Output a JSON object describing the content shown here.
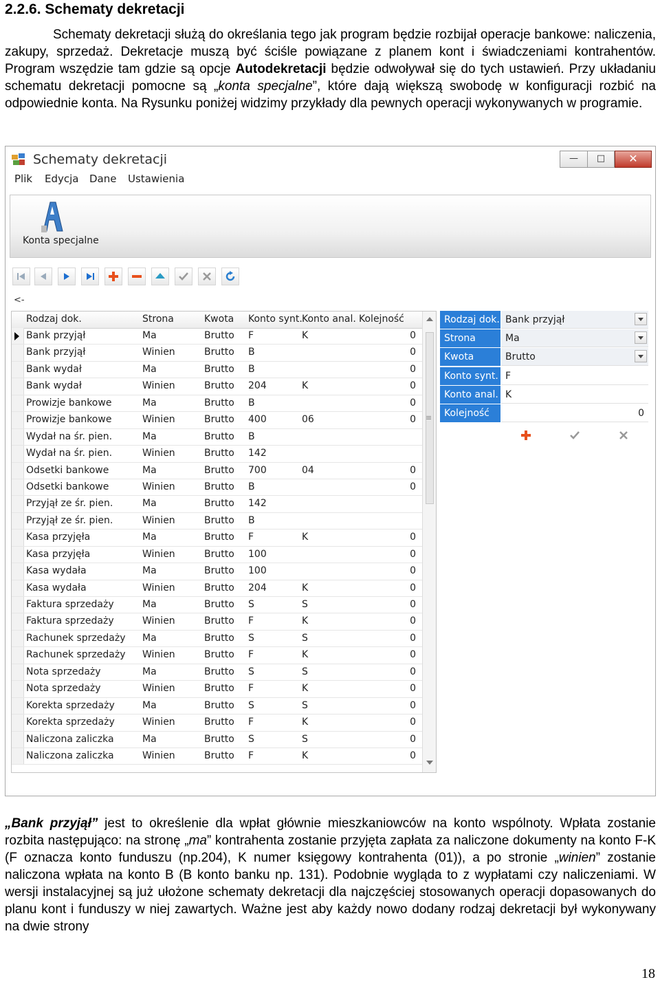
{
  "heading": "2.2.6. Schematy dekretacji",
  "para1": {
    "t1": "Schematy dekretacji służą do określania tego jak program będzie rozbijał operacje bankowe: naliczenia, zakupy, sprzedaż. Dekretacje muszą być ściśle powiązane z planem kont i świadczeniami kontrahentów. Program wszędzie tam gdzie są opcje ",
    "b1": "Autodekretacji",
    "t2": " będzie odwoływał się do tych ustawień. Przy układaniu schematu dekretacji pomocne są „",
    "i1": "konta specjalne",
    "t3": "”, które dają większą swobodę w konfiguracji rozbić na odpowiednie konta. Na Rysunku poniżej widzimy przykłady dla pewnych operacji wykonywanych w programie."
  },
  "window": {
    "title": "Schematy dekretacji",
    "controls": {
      "minimize": "—",
      "maximize": "□",
      "close": "✕"
    },
    "menu": [
      "Plik",
      "Edycja",
      "Dane",
      "Ustawienia"
    ],
    "ribbon_button": "Konta specjalne",
    "collapse": "<-",
    "nav_icons": [
      "first-record-icon",
      "prev-record-icon",
      "next-record-icon",
      "last-record-icon",
      "add-icon",
      "remove-icon",
      "up-icon",
      "confirm-icon",
      "cancel-icon",
      "refresh-icon"
    ],
    "columns": [
      "Rodzaj dok.",
      "Strona",
      "Kwota",
      "Konto synt.",
      "Konto anal.",
      "Kolejność"
    ],
    "rows": [
      [
        "Bank przyjął",
        "Ma",
        "Brutto",
        "F",
        "K",
        "0"
      ],
      [
        "Bank przyjął",
        "Winien",
        "Brutto",
        "B",
        "",
        "0"
      ],
      [
        "Bank wydał",
        "Ma",
        "Brutto",
        "B",
        "",
        "0"
      ],
      [
        "Bank wydał",
        "Winien",
        "Brutto",
        "204",
        "K",
        "0"
      ],
      [
        "Prowizje bankowe",
        "Ma",
        "Brutto",
        "B",
        "",
        "0"
      ],
      [
        "Prowizje bankowe",
        "Winien",
        "Brutto",
        "400",
        "06",
        "0"
      ],
      [
        "Wydał na śr. pien.",
        "Ma",
        "Brutto",
        "B",
        "",
        ""
      ],
      [
        "Wydał na śr. pien.",
        "Winien",
        "Brutto",
        "142",
        "",
        ""
      ],
      [
        "Odsetki bankowe",
        "Ma",
        "Brutto",
        "700",
        "04",
        "0"
      ],
      [
        "Odsetki bankowe",
        "Winien",
        "Brutto",
        "B",
        "",
        "0"
      ],
      [
        "Przyjął ze śr. pien.",
        "Ma",
        "Brutto",
        "142",
        "",
        ""
      ],
      [
        "Przyjął ze śr. pien.",
        "Winien",
        "Brutto",
        "B",
        "",
        ""
      ],
      [
        "Kasa przyjęła",
        "Ma",
        "Brutto",
        "F",
        "K",
        "0"
      ],
      [
        "Kasa przyjęła",
        "Winien",
        "Brutto",
        "100",
        "",
        "0"
      ],
      [
        "Kasa wydała",
        "Ma",
        "Brutto",
        "100",
        "",
        "0"
      ],
      [
        "Kasa wydała",
        "Winien",
        "Brutto",
        "204",
        "K",
        "0"
      ],
      [
        "Faktura sprzedaży",
        "Ma",
        "Brutto",
        "S",
        "S",
        "0"
      ],
      [
        "Faktura sprzedaży",
        "Winien",
        "Brutto",
        "F",
        "K",
        "0"
      ],
      [
        "Rachunek sprzedaży",
        "Ma",
        "Brutto",
        "S",
        "S",
        "0"
      ],
      [
        "Rachunek sprzedaży",
        "Winien",
        "Brutto",
        "F",
        "K",
        "0"
      ],
      [
        "Nota sprzedaży",
        "Ma",
        "Brutto",
        "S",
        "S",
        "0"
      ],
      [
        "Nota sprzedaży",
        "Winien",
        "Brutto",
        "F",
        "K",
        "0"
      ],
      [
        "Korekta sprzedaży",
        "Ma",
        "Brutto",
        "S",
        "S",
        "0"
      ],
      [
        "Korekta sprzedaży",
        "Winien",
        "Brutto",
        "F",
        "K",
        "0"
      ],
      [
        "Naliczona zaliczka",
        "Ma",
        "Brutto",
        "S",
        "S",
        "0"
      ],
      [
        "Naliczona zaliczka",
        "Winien",
        "Brutto",
        "F",
        "K",
        "0"
      ]
    ],
    "detail": [
      {
        "label": "Rodzaj dok.",
        "value": "Bank przyjął",
        "dropdown": true
      },
      {
        "label": "Strona",
        "value": "Ma",
        "dropdown": true
      },
      {
        "label": "Kwota",
        "value": "Brutto",
        "dropdown": true
      },
      {
        "label": "Konto synt.",
        "value": "F",
        "dropdown": false
      },
      {
        "label": "Konto anal.",
        "value": "K",
        "dropdown": false
      },
      {
        "label": "Kolejność",
        "value": "0",
        "dropdown": false,
        "numeric": true
      }
    ],
    "accent_color": "#2b7fd8"
  },
  "para2": {
    "i1": "„Bank przyjął”",
    "t1": " jest to określenie dla wpłat głównie mieszkaniowców na konto wspólnoty. Wpłata zostanie rozbita następująco: na stronę „",
    "i2": "ma",
    "t2": "” kontrahenta zostanie przyjęta zapłata za naliczone dokumenty na konto F-K (F oznacza konto funduszu (np.204), K numer księgowy kontrahenta (01)), a po stronie „",
    "i3": "winien",
    "t3": "” zostanie naliczona wpłata na konto B (B konto banku np. 131). Podobnie wygląda to z wypłatami czy naliczeniami. W wersji instalacyjnej są już ułożone schematy dekretacji dla  najczęściej stosowanych operacji dopasowanych do planu kont i funduszy w niej zawartych. Ważne jest aby każdy nowo dodany rodzaj dekretacji był wykonywany na dwie strony"
  },
  "page_number": "18"
}
